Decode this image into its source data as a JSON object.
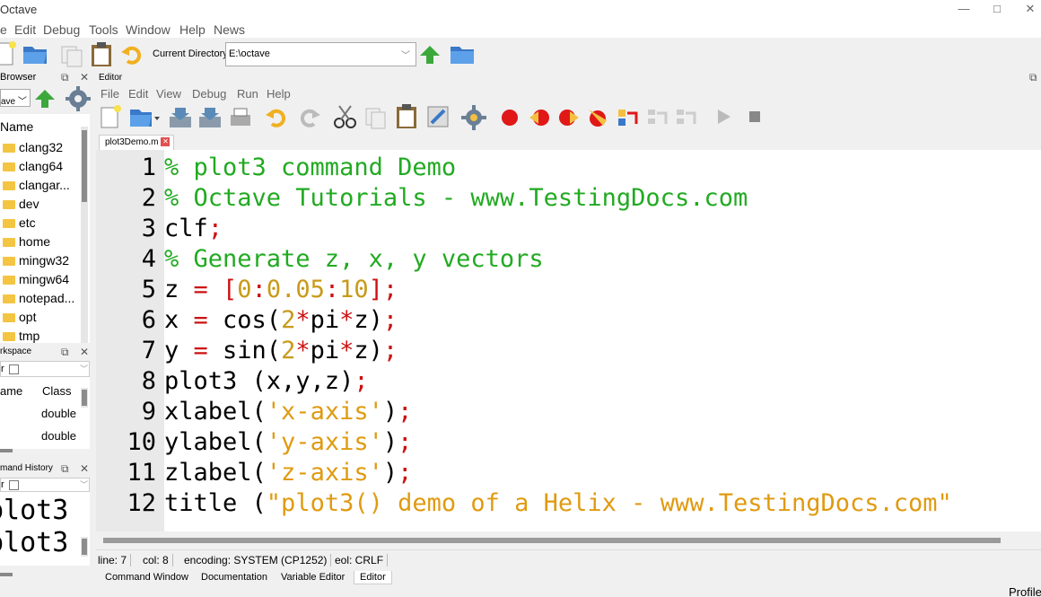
{
  "window": {
    "title": "Octave",
    "controls": [
      "—",
      "□",
      "✕"
    ]
  },
  "main_menu": [
    "e",
    "Edit",
    "Debug",
    "Tools",
    "Window",
    "Help",
    "News"
  ],
  "toolbar": {
    "current_directory_label": "Current Directory:",
    "current_directory_value": "E:\\octave"
  },
  "file_browser": {
    "title": "Browser",
    "path_value": "ave",
    "column_header": "Name",
    "items": [
      "clang32",
      "clang64",
      "clangar...",
      "dev",
      "etc",
      "home",
      "mingw32",
      "mingw64",
      "notepad...",
      "opt",
      "tmp"
    ]
  },
  "workspace": {
    "title": "rkspace",
    "filter_label": "r",
    "columns": [
      "ame",
      "Class"
    ],
    "rows": [
      {
        "name": "",
        "class": "double"
      },
      {
        "name": "",
        "class": "double"
      }
    ]
  },
  "command_history": {
    "title": "mand History",
    "filter_label": "r",
    "entries": [
      "plot3",
      "plot3"
    ]
  },
  "editor": {
    "panel_title": "Editor",
    "menu": [
      "File",
      "Edit",
      "View",
      "Debug",
      "Run",
      "Help"
    ],
    "tab_label": "plot3Demo.m",
    "code_lines": [
      {
        "n": "1",
        "parts": [
          [
            "cm",
            "% plot3 command Demo"
          ]
        ]
      },
      {
        "n": "2",
        "parts": [
          [
            "cm",
            "% Octave Tutorials - www.TestingDocs.com"
          ]
        ]
      },
      {
        "n": "3",
        "parts": [
          [
            "kw",
            "clf"
          ],
          [
            "op",
            ";"
          ]
        ]
      },
      {
        "n": "4",
        "parts": [
          [
            "cm",
            "% Generate z, x, y vectors"
          ]
        ]
      },
      {
        "n": "5",
        "parts": [
          [
            "kw",
            "z "
          ],
          [
            "op",
            "= ["
          ],
          [
            "num",
            "0"
          ],
          [
            "op",
            ":"
          ],
          [
            "num",
            "0.05"
          ],
          [
            "op",
            ":"
          ],
          [
            "num",
            "10"
          ],
          [
            "op",
            "];"
          ]
        ]
      },
      {
        "n": "6",
        "parts": [
          [
            "kw",
            "x "
          ],
          [
            "op",
            "= "
          ],
          [
            "kw",
            "cos("
          ],
          [
            "num",
            "2"
          ],
          [
            "op",
            "*"
          ],
          [
            "kw",
            "pi"
          ],
          [
            "op",
            "*"
          ],
          [
            "kw",
            "z)"
          ],
          [
            "op",
            ";"
          ]
        ]
      },
      {
        "n": "7",
        "parts": [
          [
            "kw",
            "y "
          ],
          [
            "op",
            "= "
          ],
          [
            "kw",
            "sin("
          ],
          [
            "num",
            "2"
          ],
          [
            "op",
            "*"
          ],
          [
            "kw",
            "pi"
          ],
          [
            "op",
            "*"
          ],
          [
            "kw",
            "z)"
          ],
          [
            "op",
            ";"
          ]
        ]
      },
      {
        "n": "8",
        "parts": [
          [
            "kw",
            "plot3 (x,y,z)"
          ],
          [
            "op",
            ";"
          ]
        ]
      },
      {
        "n": "9",
        "parts": [
          [
            "kw",
            "xlabel("
          ],
          [
            "str",
            "'x-axis'"
          ],
          [
            "kw",
            ")"
          ],
          [
            "op",
            ";"
          ]
        ]
      },
      {
        "n": "10",
        "parts": [
          [
            "kw",
            "ylabel("
          ],
          [
            "str",
            "'y-axis'"
          ],
          [
            "kw",
            ")"
          ],
          [
            "op",
            ";"
          ]
        ]
      },
      {
        "n": "11",
        "parts": [
          [
            "kw",
            "zlabel("
          ],
          [
            "str",
            "'z-axis'"
          ],
          [
            "kw",
            ")"
          ],
          [
            "op",
            ";"
          ]
        ]
      },
      {
        "n": "12",
        "parts": [
          [
            "kw",
            "title ("
          ],
          [
            "str",
            "\"plot3() demo of a Helix - www.TestingDocs.com\""
          ]
        ]
      }
    ]
  },
  "status": {
    "line": "line: 7",
    "col": "col: 8",
    "encoding": "encoding: SYSTEM (CP1252)",
    "eol": "eol: CRLF"
  },
  "bottom_tabs": [
    "Command Window",
    "Documentation",
    "Variable Editor",
    "Editor"
  ],
  "corner_text": "Profile",
  "colors": {
    "comment": "#22aa22",
    "operator": "#cc1111",
    "number": "#c89a1a",
    "string": "#e09a10"
  }
}
